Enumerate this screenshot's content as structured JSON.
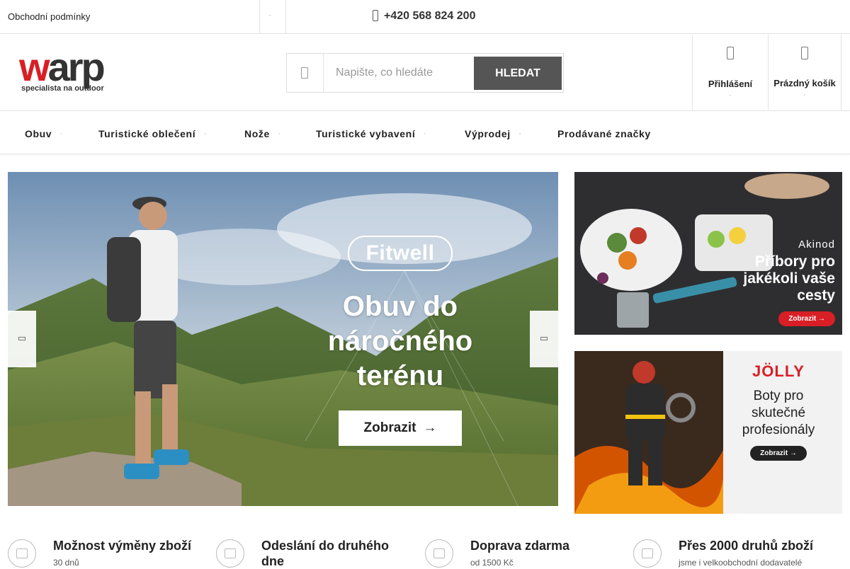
{
  "topbar": {
    "terms_link": "Obchodní podmínky",
    "phone": "+420 568 824 200"
  },
  "header": {
    "logo_word_a": "w",
    "logo_word_b": "arp",
    "logo_tagline": "specialista na outdoor",
    "search_placeholder": "Napište, co hledáte",
    "search_button": "HLEDAT",
    "login_label": "Přihlášení",
    "cart_label": "Prázdný košík"
  },
  "nav": {
    "items": [
      {
        "label": "Obuv",
        "has_caret": true
      },
      {
        "label": "Turistické oblečení",
        "has_caret": true
      },
      {
        "label": "Nože",
        "has_caret": true
      },
      {
        "label": "Turistické vybavení",
        "has_caret": true
      },
      {
        "label": "Výprodej",
        "has_caret": true
      },
      {
        "label": "Prodávané značky",
        "has_caret": false
      }
    ]
  },
  "hero": {
    "brand": "Fitwell",
    "headline_line1": "Obuv do",
    "headline_line2": "náročného",
    "headline_line3": "terénu",
    "button": "Zobrazit",
    "button_arrow": "→"
  },
  "banners": [
    {
      "brand": "Akinod",
      "title_line1": "Příbory pro",
      "title_line2": "jakékoli vaše",
      "title_line3": "cesty",
      "button": "Zobrazit →"
    },
    {
      "brand": "JÖLLY",
      "title_line1": "Boty pro",
      "title_line2": "skutečné",
      "title_line3": "profesionály",
      "button": "Zobrazit →"
    }
  ],
  "features": [
    {
      "icon": "exchange-icon",
      "title": "Možnost výměny zboží",
      "subtitle": "30 dnů"
    },
    {
      "icon": "clock-icon",
      "title": "Odeslání do druhého dne",
      "subtitle": ""
    },
    {
      "icon": "truck-icon",
      "title": "Doprava zdarma",
      "subtitle": "od 1500 Kč"
    },
    {
      "icon": "warehouse-icon",
      "title": "Přes 2000 druhů zboží",
      "subtitle": "jsme i velkoobchodní dodavatelé"
    }
  ],
  "colors": {
    "brand_red": "#d81f26",
    "search_button": "#555555",
    "border": "#e3e3e3"
  }
}
